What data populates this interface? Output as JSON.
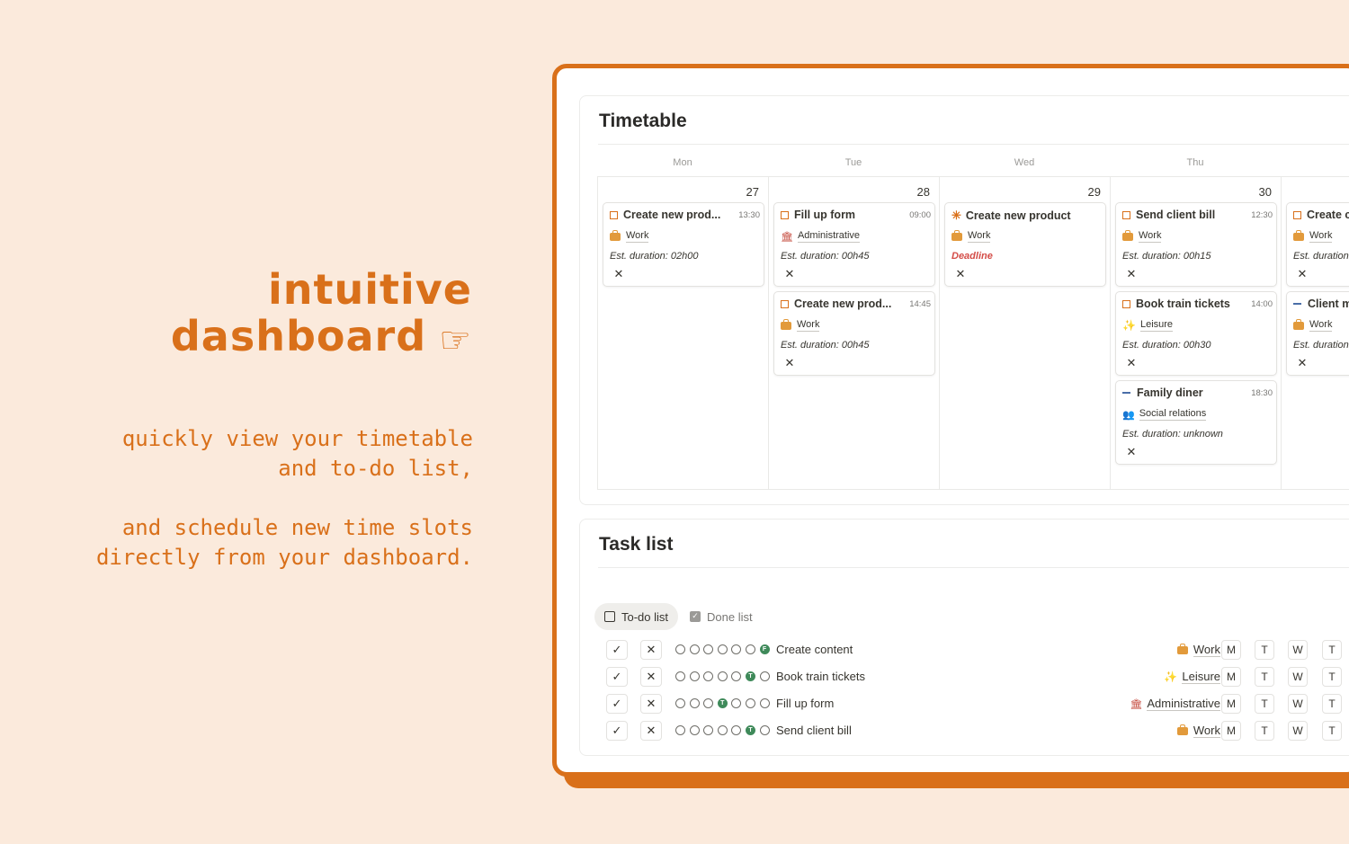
{
  "hero": {
    "title_line1": "intuitive",
    "title_line2": "dashboard",
    "title_icon": "☞",
    "sub1_line1": "quickly view your timetable",
    "sub1_line2": "and to-do list,",
    "sub2_line1": "and schedule new time slots",
    "sub2_line2": "directly from your dashboard."
  },
  "colors": {
    "accent": "#d9701a",
    "background": "#fbeadc",
    "deadline": "#d44c47",
    "progress": "#3f8a5a"
  },
  "timetable": {
    "title": "Timetable",
    "days": [
      {
        "name": "Mon",
        "num": "27",
        "events": [
          {
            "icon": "checkbox-icon",
            "title": "Create new prod...",
            "time": "13:30",
            "tag": "Work",
            "tag_icon": "briefcase-icon",
            "est": "Est. duration: 02h00"
          }
        ]
      },
      {
        "name": "Tue",
        "num": "28",
        "events": [
          {
            "icon": "checkbox-icon",
            "title": "Fill up form",
            "time": "09:00",
            "tag": "Administrative",
            "tag_icon": "bank-icon",
            "est": "Est. duration: 00h45"
          },
          {
            "icon": "checkbox-icon",
            "title": "Create new prod...",
            "time": "14:45",
            "tag": "Work",
            "tag_icon": "briefcase-icon",
            "est": "Est. duration: 00h45"
          }
        ]
      },
      {
        "name": "Wed",
        "num": "29",
        "events": [
          {
            "icon": "star-icon",
            "title": "Create new product",
            "time": "",
            "tag": "Work",
            "tag_icon": "briefcase-icon",
            "est": "Deadline"
          }
        ]
      },
      {
        "name": "Thu",
        "num": "30",
        "events": [
          {
            "icon": "checkbox-icon",
            "title": "Send client bill",
            "time": "12:30",
            "tag": "Work",
            "tag_icon": "briefcase-icon",
            "est": "Est. duration: 00h15"
          },
          {
            "icon": "checkbox-icon",
            "title": "Book train tickets",
            "time": "14:00",
            "tag": "Leisure",
            "tag_icon": "leisure-icon",
            "est": "Est. duration: 00h30"
          },
          {
            "icon": "dash-icon",
            "title": "Family diner",
            "time": "18:30",
            "tag": "Social relations",
            "tag_icon": "people-icon",
            "est": "Est. duration: unknown"
          }
        ]
      },
      {
        "name": "",
        "num": "",
        "events": [
          {
            "icon": "checkbox-icon",
            "title": "Create c",
            "time": "",
            "tag": "Work",
            "tag_icon": "briefcase-icon",
            "est": "Est. duration"
          },
          {
            "icon": "dash-icon",
            "title": "Client m",
            "time": "",
            "tag": "Work",
            "tag_icon": "briefcase-icon",
            "est": "Est. duration"
          }
        ]
      }
    ],
    "close_glyph": "✕"
  },
  "tasklist": {
    "title": "Task list",
    "tab_todo": "To-do list",
    "tab_done": "Done list",
    "check_glyph": "✓",
    "cross_glyph": "✕",
    "day_buttons": [
      "M",
      "T",
      "W",
      "T"
    ],
    "tasks": [
      {
        "name": "Create content",
        "tag": "Work",
        "tag_icon": "briefcase-icon",
        "progress_index": 6,
        "progress_letter": "F"
      },
      {
        "name": "Book train tickets",
        "tag": "Leisure",
        "tag_icon": "leisure-icon",
        "progress_index": 5,
        "progress_letter": "T"
      },
      {
        "name": "Fill up form",
        "tag": "Administrative",
        "tag_icon": "bank-icon",
        "progress_index": 3,
        "progress_letter": "T"
      },
      {
        "name": "Send client bill",
        "tag": "Work",
        "tag_icon": "briefcase-icon",
        "progress_index": 5,
        "progress_letter": "T"
      }
    ]
  }
}
